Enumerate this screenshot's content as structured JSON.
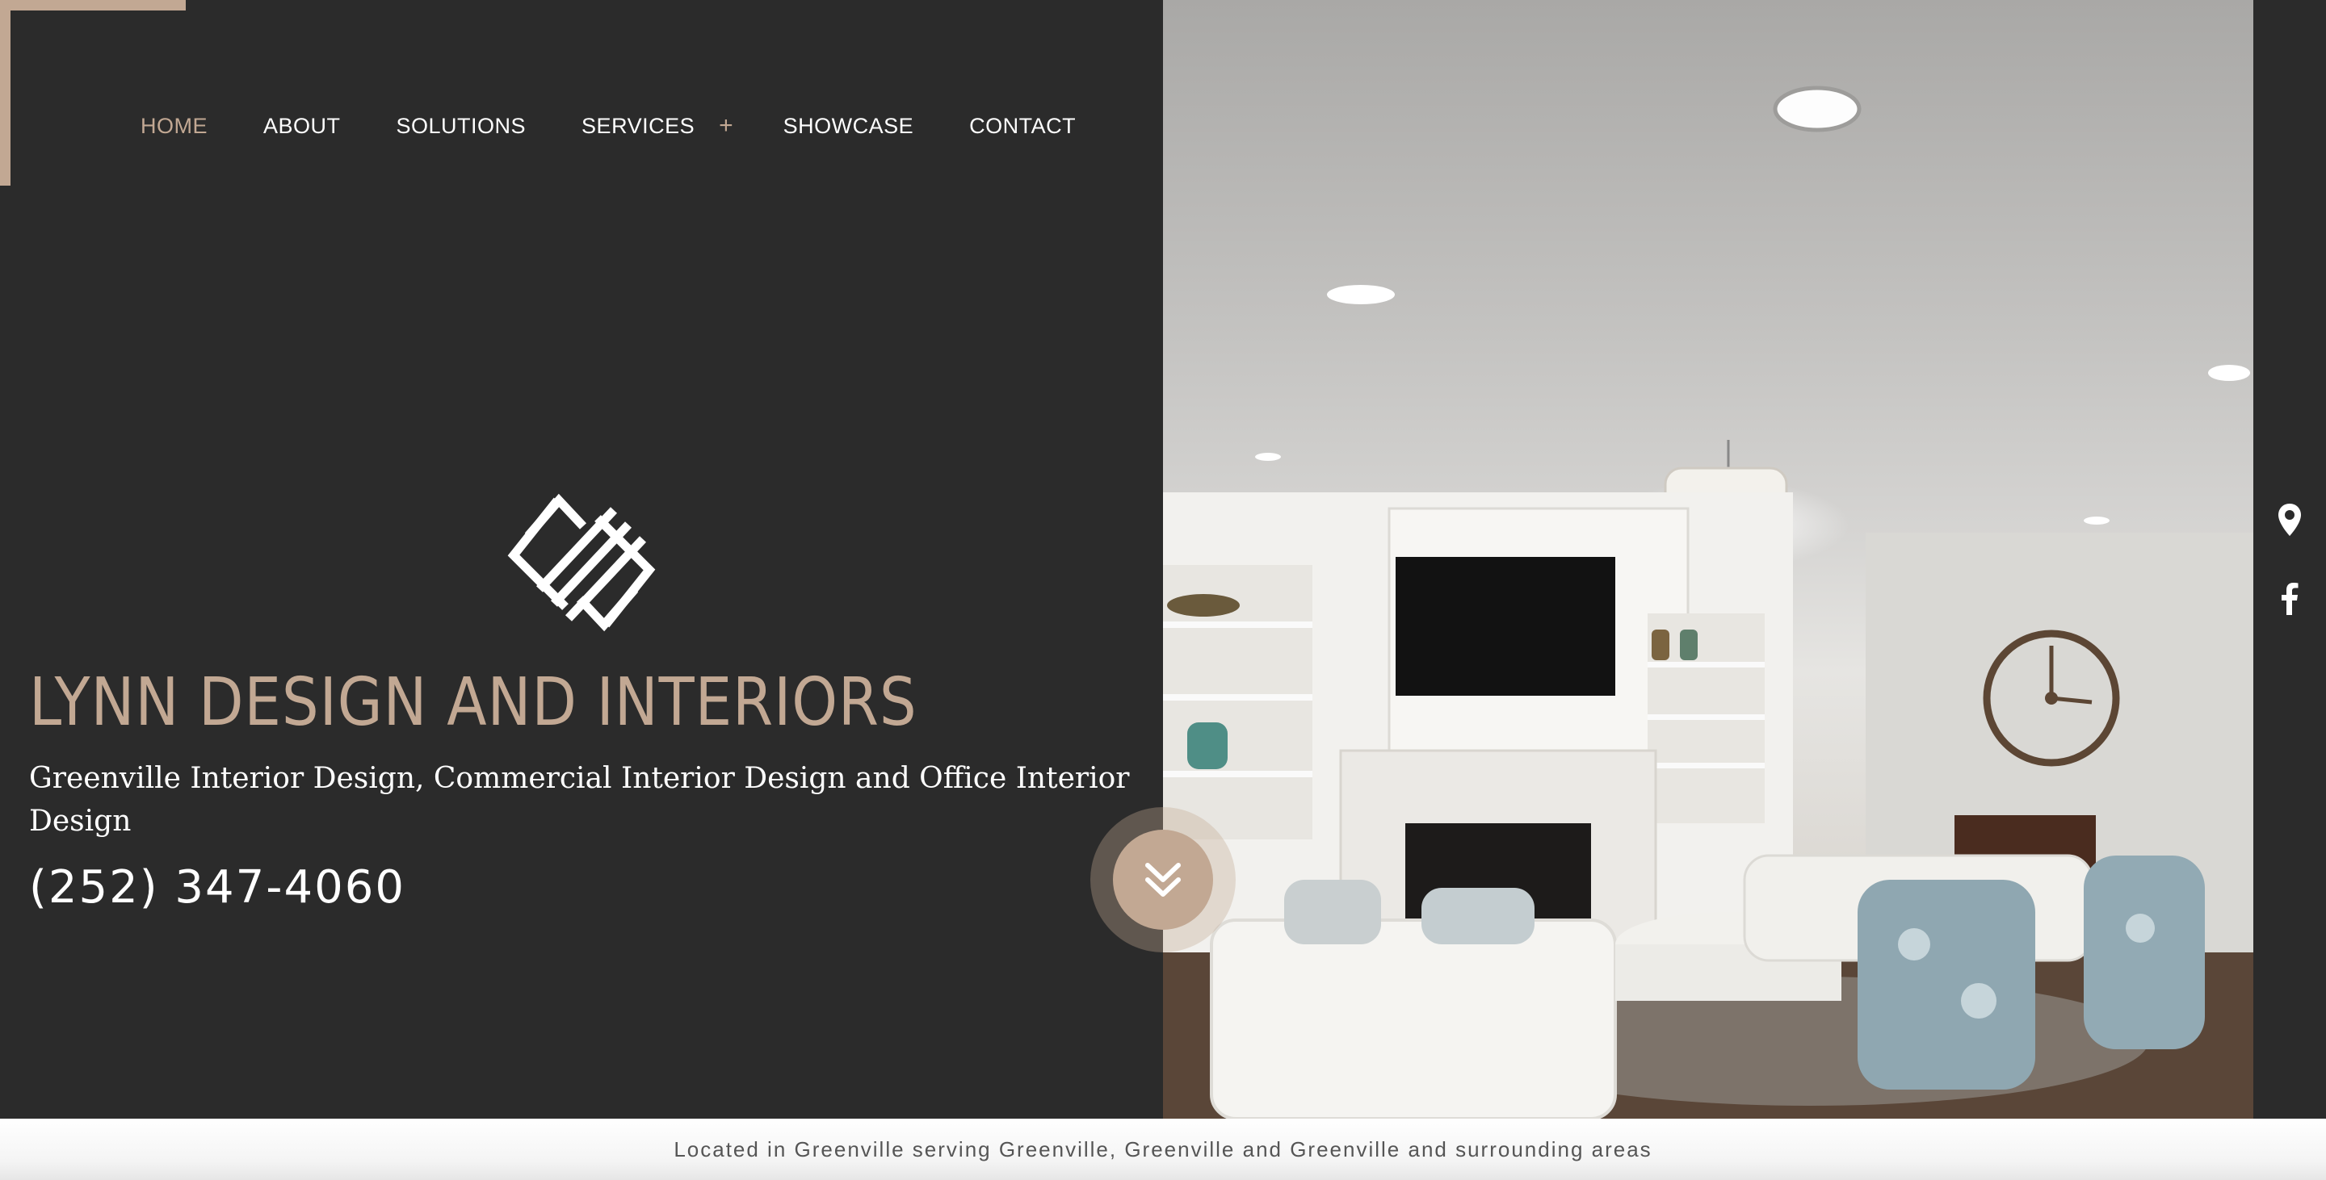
{
  "nav": {
    "items": [
      {
        "label": "HOME",
        "active": true
      },
      {
        "label": "ABOUT",
        "active": false
      },
      {
        "label": "SOLUTIONS",
        "active": false
      },
      {
        "label": "SERVICES",
        "active": false,
        "has_submenu": true
      },
      {
        "label": "SHOWCASE",
        "active": false
      },
      {
        "label": "CONTACT",
        "active": false
      }
    ],
    "submenu_glyph": "+"
  },
  "brand": {
    "title": "LYNN DESIGN AND INTERIORS",
    "subtitle": "Greenville Interior Design, Commercial Interior Design and Office Interior Design",
    "phone": "(252) 347-4060",
    "logo_icon": "diamond-monogram-icon"
  },
  "hero": {
    "image": "living-room-photo"
  },
  "side_icons": [
    "map-pin-icon",
    "facebook-icon"
  ],
  "scroll_button": {
    "icon": "double-chevron-down-icon"
  },
  "footer": {
    "text": "Located in Greenville serving Greenville, Greenville and Greenville and surrounding areas"
  },
  "colors": {
    "accent": "#c2a893",
    "dark": "#2b2b2b",
    "text_light": "#ffffff",
    "footer_text": "#555555"
  }
}
